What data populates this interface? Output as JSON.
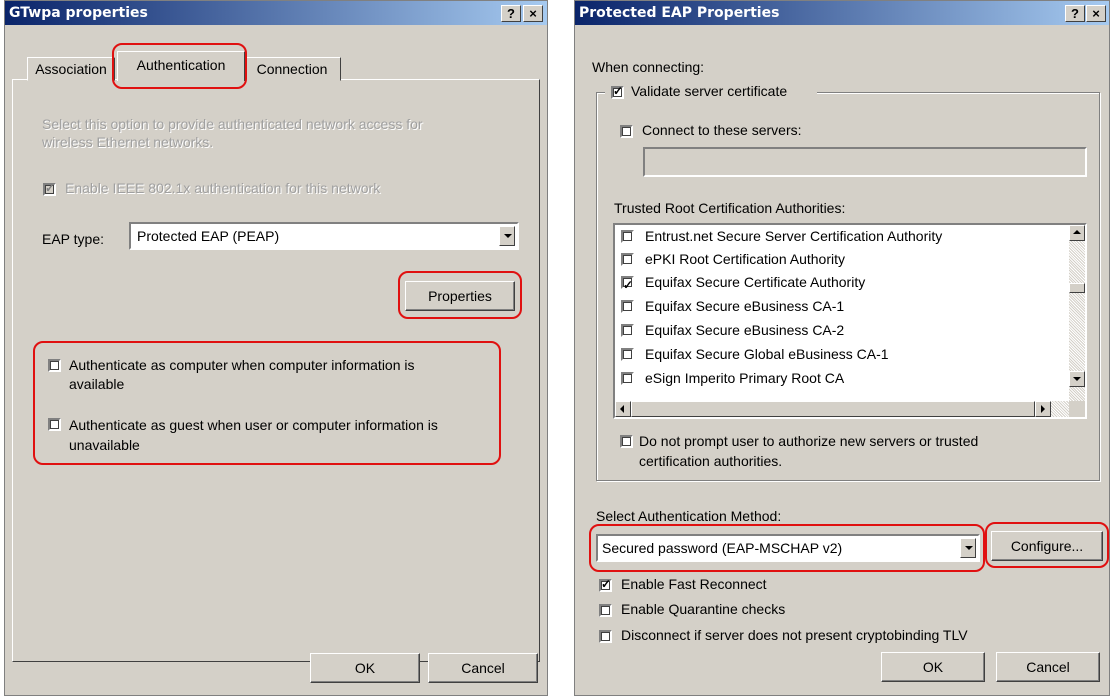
{
  "left_dialog": {
    "title": "GTwpa properties",
    "help_btn": "?",
    "close_btn": "×",
    "tabs": [
      {
        "label": "Association"
      },
      {
        "label": "Authentication"
      },
      {
        "label": "Connection"
      }
    ],
    "description": [
      "Select this option to provide authenticated network access for",
      "wireless Ethernet networks."
    ],
    "enable_8021x": {
      "label": "Enable IEEE 802.1x authentication for this network",
      "checked": true,
      "disabled": true
    },
    "eap_type_label": "EAP type:",
    "eap_type_value": "Protected EAP (PEAP)",
    "properties_btn": "Properties",
    "auth_computer": {
      "line1": "Authenticate as computer when computer information is",
      "line2": "available",
      "checked": false
    },
    "auth_guest": {
      "line1": "Authenticate as guest when user or computer information is",
      "line2": "unavailable",
      "checked": false
    },
    "ok_btn": "OK",
    "cancel_btn": "Cancel"
  },
  "right_dialog": {
    "title": "Protected EAP Properties",
    "help_btn": "?",
    "close_btn": "×",
    "when_connecting": "When connecting:",
    "validate_cert": {
      "label": "Validate server certificate",
      "checked": true
    },
    "connect_servers": {
      "label": "Connect to these servers:",
      "checked": false,
      "value": ""
    },
    "trusted_root_label": "Trusted Root Certification Authorities:",
    "cas": [
      {
        "label": "Entrust.net Secure Server Certification Authority",
        "checked": false
      },
      {
        "label": "ePKI Root Certification Authority",
        "checked": false
      },
      {
        "label": "Equifax Secure Certificate Authority",
        "checked": true
      },
      {
        "label": "Equifax Secure eBusiness CA-1",
        "checked": false
      },
      {
        "label": "Equifax Secure eBusiness CA-2",
        "checked": false
      },
      {
        "label": "Equifax Secure Global eBusiness CA-1",
        "checked": false
      },
      {
        "label": "eSign Imperito Primary Root CA",
        "checked": false
      }
    ],
    "no_prompt": {
      "line1": "Do not prompt user to authorize new servers or trusted",
      "line2": "certification authorities.",
      "checked": false
    },
    "select_auth_label": "Select Authentication Method:",
    "auth_method_value": "Secured password (EAP-MSCHAP v2)",
    "configure_btn": "Configure...",
    "fast_reconnect": {
      "label": "Enable Fast Reconnect",
      "checked": true
    },
    "quarantine": {
      "label": "Enable Quarantine checks",
      "checked": false
    },
    "cryptobinding": {
      "label": "Disconnect if server does not present cryptobinding TLV",
      "checked": false
    },
    "ok_btn": "OK",
    "cancel_btn": "Cancel"
  }
}
